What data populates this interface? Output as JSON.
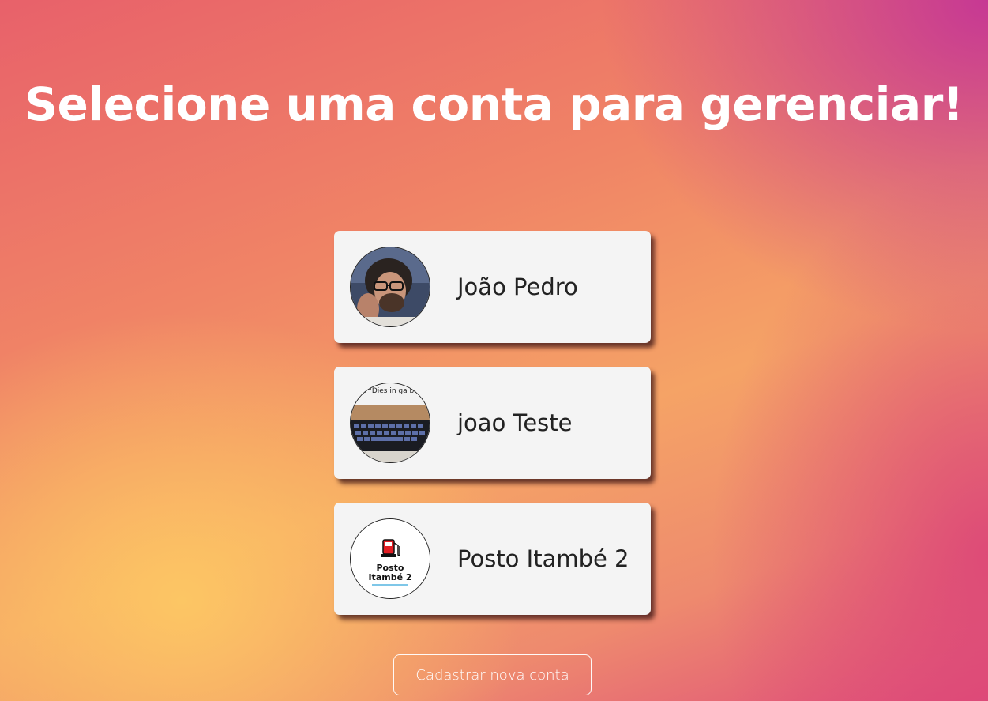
{
  "header": {
    "title": "Selecione uma conta para gerenciar!"
  },
  "accounts": [
    {
      "name": "João Pedro",
      "avatar": "profile-photo-icon"
    },
    {
      "name": "joao Teste",
      "avatar": "keyboard-photo-icon",
      "avatar_caption": "her: \"Dies in ga board:"
    },
    {
      "name": "Posto Itambé 2",
      "avatar": "fuel-pump-logo-icon",
      "logo_text": [
        "Posto",
        "Itambé 2"
      ]
    }
  ],
  "actions": {
    "new_account_label": "Cadastrar nova conta"
  },
  "colors": {
    "card_background": "#f4f4f4",
    "title_text": "#ffffff",
    "fuel_pump_red": "#e31e24"
  }
}
